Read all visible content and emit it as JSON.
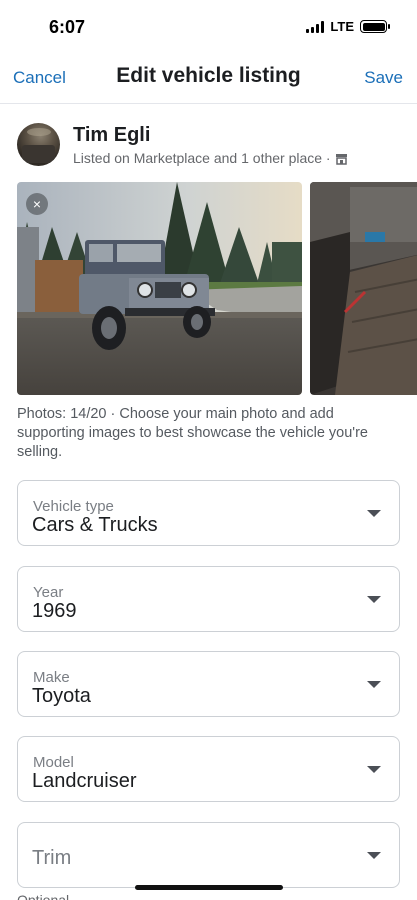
{
  "status_bar": {
    "time": "6:07",
    "network": "LTE"
  },
  "header": {
    "cancel": "Cancel",
    "title": "Edit vehicle listing",
    "save": "Save"
  },
  "seller": {
    "name": "Tim Egli",
    "subtitle": "Listed on Marketplace and 1 other place ·"
  },
  "photos": {
    "caption": "Photos: 14/20 · Choose your main photo and add supporting images to best showcase the vehicle you're selling.",
    "remove_icon": "×"
  },
  "fields": [
    {
      "label": "Vehicle type",
      "value": "Cars & Trucks"
    },
    {
      "label": "Year",
      "value": "1969"
    },
    {
      "label": "Make",
      "value": "Toyota"
    },
    {
      "label": "Model",
      "value": "Landcruiser"
    },
    {
      "placeholder": "Trim"
    }
  ],
  "optional_note": "Optional",
  "icons": {
    "store": "store-icon",
    "dropdown": "caret-down-icon",
    "remove": "close-icon"
  }
}
